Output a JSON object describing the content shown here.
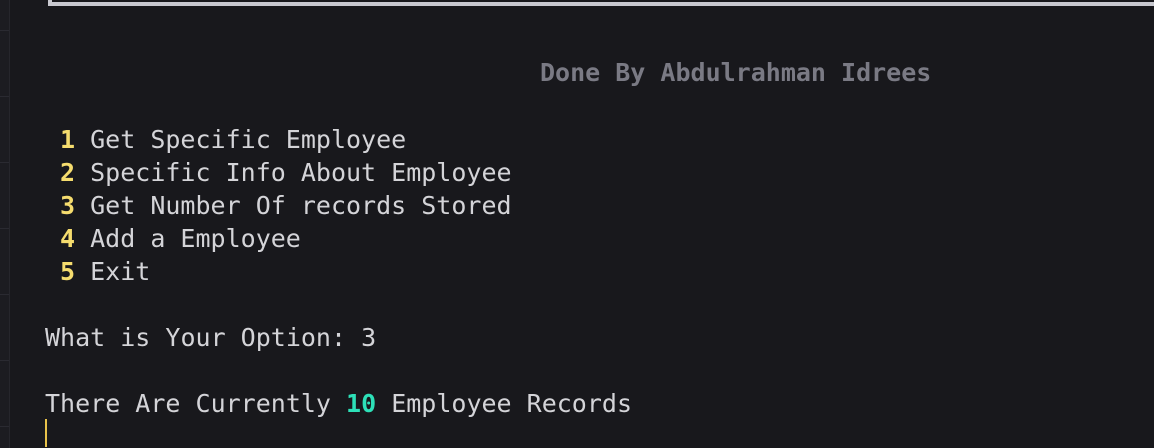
{
  "credit": "Done By Abdulrahman Idrees",
  "menu": [
    {
      "number": "1",
      "label": "Get Specific Employee"
    },
    {
      "number": "2",
      "label": "Specific Info About Employee"
    },
    {
      "number": "3",
      "label": "Get Number Of records Stored"
    },
    {
      "number": "4",
      "label": "Add a Employee"
    },
    {
      "number": "5",
      "label": "Exit"
    }
  ],
  "prompt": {
    "label": "What is Your Option: ",
    "value": "3"
  },
  "result": {
    "prefix": "There Are Currently ",
    "count": "10",
    "suffix": " Employee Records"
  },
  "colors": {
    "background": "#18181c",
    "text": "#d4d4d8",
    "menu_number": "#f5dc6e",
    "count_highlight": "#2de0b8",
    "credit": "#7a7a84",
    "cursor": "#e8c24a"
  }
}
